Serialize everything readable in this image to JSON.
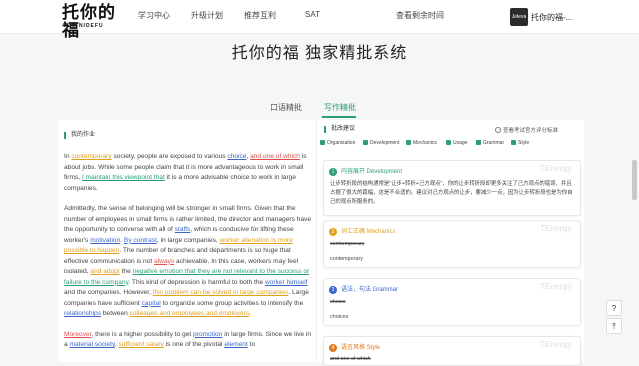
{
  "header": {
    "logo_main": "托你的福",
    "logo_sub": "TUO NIDEFU",
    "nav": [
      "学习中心",
      "升级计划",
      "推荐互利",
      "SAT"
    ],
    "remaining_time": "查看剩余时间",
    "avatar_text": "Jeleva",
    "username": "托你的福-..."
  },
  "title": "托你的福 独家精批系统",
  "tabs": [
    "口语精批",
    "写作精批"
  ],
  "active_tab": "写作精批",
  "essay": {
    "section_title": "我的作业",
    "p1": {
      "a": "In ",
      "b": "contemporary",
      "c": " society, people are exposed to various ",
      "d": "choice",
      "e": ", ",
      "f": "and one of which",
      "g": " is about jobs. While some people claim that it is more advantageous to work in small firms, ",
      "h": "I maintain this viewpoint that",
      "i": " it is a more advisable choice to work in large companies."
    },
    "p2": {
      "a": "Admittedly, the sense of belonging will be stronger in small firms. Given that the number of employees in small firms is rather limited, the director and managers have the opportunity to converse with all of ",
      "b": "staffs",
      "c": ", which is conducive for lifting these worker's ",
      "d": "motivation",
      "e": ". ",
      "f": "By contrast",
      "g": ", in large companies, ",
      "h": "worker alienation is more possible to happen",
      "i": ". The number of branches and departments is so huge that effective communication is not ",
      "j": "always",
      "k": " achievable. In this case, workers may feel isolated, ",
      "l": "and adopt",
      "m": " the ",
      "n": "negative emotion that they are not relevant to the success or failure to the company",
      "o": ". This kind of depression is harmful to both the ",
      "p": "worker himself",
      "q": " and the companies. However, ",
      "r": "this problem can be solved in large companies",
      "s": ". Large companies have sufficient ",
      "t": "capital",
      "u": " to organize some group activities to intensify the ",
      "v": "relationships",
      "w": " between ",
      "x": "colleages and employees and employers",
      "y": "."
    },
    "p3": {
      "a": "Moreover",
      "b": ", there is a higher possibility to get ",
      "c": "promotion",
      "d": " in large firms. Since we live in a ",
      "e": "material society",
      "f": ", ",
      "g": "sufficient salary",
      "h": " is one of the pivotal ",
      "i": "element",
      "j": " to"
    }
  },
  "suggestions": {
    "header": "批改建议",
    "view_standard": "查看考试官方评分标准",
    "filters": [
      "Organization",
      "Development",
      "Mechanics",
      "Usage",
      "Grammar",
      "Style"
    ],
    "watermark": "TEnergy",
    "cards": [
      {
        "num": "1",
        "title": "内容展开 Development",
        "text": "让步转折段的结构通常是“让步+转折+己方观点”，你的让步转折段却更多关注了己方观点的错误，并且占据了很大的篇幅，这是不合适的。建议对己方观点的让步，要减少一点，因为让步转折段也是为你自己的观点所服务的。"
      },
      {
        "num": "2",
        "title": "词汇正确 Mechanics",
        "orig": "comtemporary",
        "fix": "contemporary"
      },
      {
        "num": "3",
        "title": "语法，句法 Grammar",
        "orig": "choice",
        "fix": "choices"
      },
      {
        "num": "4",
        "title": "语言风格 Style",
        "orig": "and one of which"
      }
    ]
  },
  "float_buttons": [
    "?",
    "⤒"
  ],
  "colors": {
    "accent": "#2e9e72",
    "orange": "#e0a020",
    "blue": "#3a67c9",
    "red": "#e0504a"
  }
}
